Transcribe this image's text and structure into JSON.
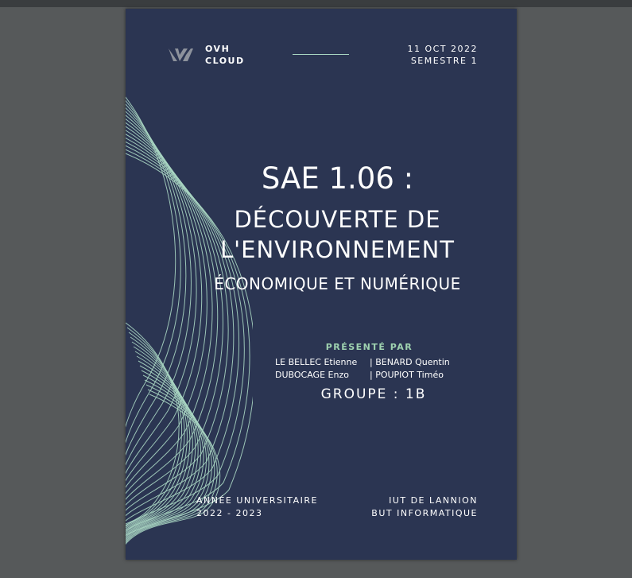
{
  "header": {
    "logo_line1": "OVH",
    "logo_line2": "CLOUD",
    "date": "11 OCT 2022",
    "semester": "SEMESTRE 1"
  },
  "title": {
    "line1": "SAE 1.06 :",
    "line2": "DÉCOUVERTE DE",
    "line3": "L'ENVIRONNEMENT",
    "line4": "ÉCONOMIQUE ET NUMÉRIQUE"
  },
  "presented": {
    "label": "PRÉSENTÉ PAR",
    "members": [
      "LE BELLEC Etienne",
      "| BENARD Quentin",
      "DUBOCAGE Enzo",
      "| POUPIOT Timéo"
    ],
    "group": "GROUPE : 1B"
  },
  "footer": {
    "year_label": "ANNÉE UNIVERSITAIRE",
    "year": "2022 - 2023",
    "school": "IUT  DE LANNION",
    "program": "BUT INFORMATIQUE"
  },
  "colors": {
    "background": "#2b3552",
    "accent": "#9fd3b0",
    "viewer_bg": "#56595a"
  },
  "icons": [
    "ovh-logo-icon"
  ]
}
